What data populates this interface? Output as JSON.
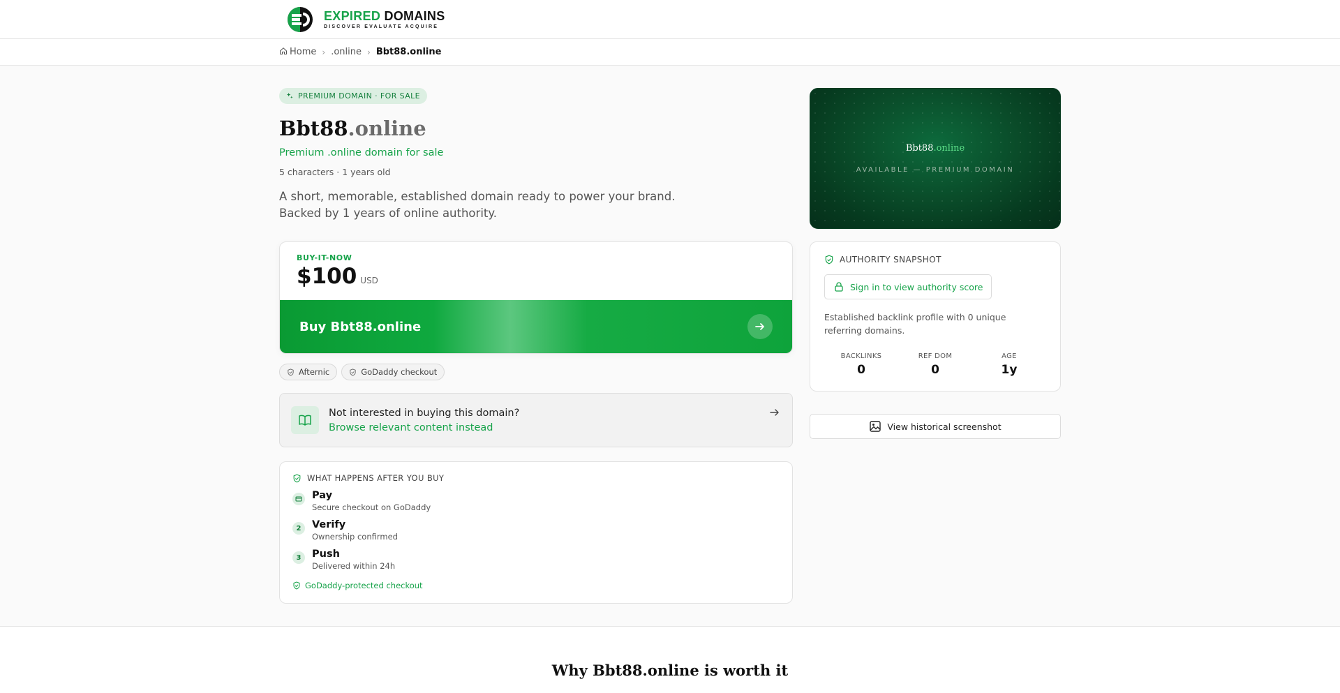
{
  "brand": {
    "name_green": "EXPIRED",
    "name_dark": "DOMAINS",
    "tagline": "DISCOVER EVALUATE ACQUIRE",
    "accent": "#17a34a"
  },
  "breadcrumb": {
    "home": "Home",
    "tld": ".online",
    "current": "Bbt88.online"
  },
  "listing": {
    "badge": "PREMIUM DOMAIN · FOR SALE",
    "name": "Bbt88",
    "tld": ".online",
    "subtitle": "Premium .online domain for sale",
    "meta": "5 characters · 1 years old",
    "desc_line1": "A short, memorable, established domain ready to power your brand.",
    "desc_line2": "Backed by 1 years of online authority."
  },
  "price": {
    "label": "BUY-IT-NOW",
    "amount": "$100",
    "currency": "USD",
    "buy_label": "Buy Bbt88.online"
  },
  "chips": [
    "Afternic",
    "GoDaddy checkout"
  ],
  "alt": {
    "question": "Not interested in buying this domain?",
    "link": "Browse relevant content instead"
  },
  "steps": {
    "heading": "WHAT HAPPENS AFTER YOU BUY",
    "items": [
      {
        "num": "",
        "title": "Pay",
        "sub": "Secure checkout on GoDaddy"
      },
      {
        "num": "2",
        "title": "Verify",
        "sub": "Ownership confirmed"
      },
      {
        "num": "3",
        "title": "Push",
        "sub": "Delivered within 24h"
      }
    ],
    "protected": "GoDaddy-protected checkout"
  },
  "hero": {
    "name": "Bbt88",
    "tld": ".online",
    "tag": "AVAILABLE — PREMIUM DOMAIN"
  },
  "authority": {
    "heading": "AUTHORITY SNAPSHOT",
    "signin": "Sign in to view authority score",
    "desc": "Established backlink profile with 0 unique referring domains.",
    "stats": [
      {
        "label": "BACKLINKS",
        "value": "0"
      },
      {
        "label": "REF DOM",
        "value": "0"
      },
      {
        "label": "AGE",
        "value": "1y"
      }
    ]
  },
  "history_button": "View historical screenshot",
  "worth_heading": "Why Bbt88.online is worth it"
}
